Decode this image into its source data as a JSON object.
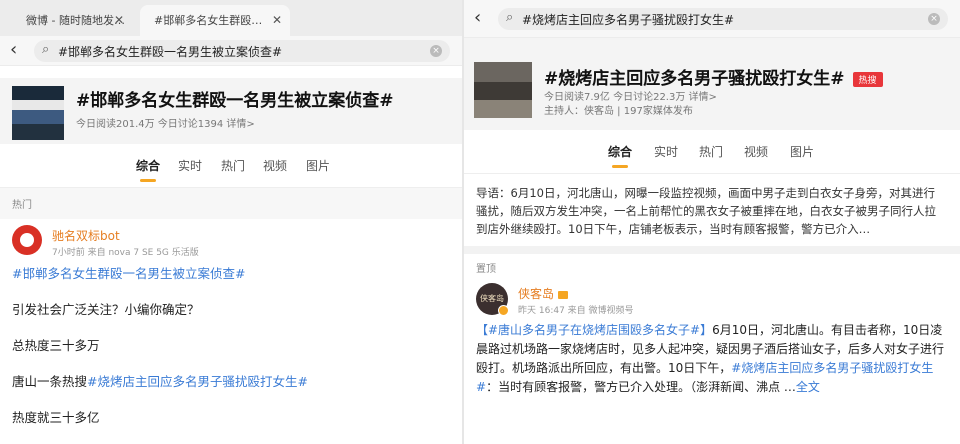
{
  "left": {
    "tabs": [
      {
        "label": "微博 - 随时随地发…"
      },
      {
        "label": "#邯郸多名女生群殴…"
      }
    ],
    "search_query": "#邯郸多名女生群殴一名男生被立案侦查#",
    "topic": {
      "title": "#邯郸多名女生群殴一名男生被立案侦查#",
      "stats": "今日阅读201.4万 今日讨论1394 详情>"
    },
    "categories": [
      "综合",
      "实时",
      "热门",
      "视频",
      "图片"
    ],
    "section_label": "热门",
    "post": {
      "username": "驰名双标bot",
      "meta": "7小时前 来自 nova 7 SE 5G 乐活版",
      "hashtag": "#邯郸多名女生群殴一名男生被立案侦查#",
      "line1": "引发社会广泛关注？小编你确定？",
      "line2": "总热度三十多万",
      "line3_prefix": "唐山一条热搜",
      "line3_tag": "#烧烤店主回应多名男子骚扰殴打女生#",
      "line4": "热度就三十多亿"
    }
  },
  "right": {
    "search_query": "#烧烤店主回应多名男子骚扰殴打女生#",
    "topic": {
      "title": "#烧烤店主回应多名男子骚扰殴打女生#",
      "badge": "热搜",
      "stats": "今日阅读7.9亿 今日讨论22.3万 详情>",
      "host": "主持人：侠客岛 | 197家媒体发布"
    },
    "categories": [
      "综合",
      "实时",
      "热门",
      "视频",
      "图片"
    ],
    "intro": "导语：6月10日，河北唐山，网曝一段监控视频，画面中男子走到白衣女子身旁，对其进行骚扰，随后双方发生冲突，一名上前帮忙的黑衣女子被重摔在地，白衣女子被男子同行人拉到店外继续殴打。10日下午，店铺老板表示，当时有顾客报警，警方已介入…",
    "pin_label": "置顶",
    "post": {
      "avatar_text": "侠客岛",
      "username": "侠客岛",
      "meta": "昨天 16:47 来自 微博视频号",
      "tag1": "【#唐山多名男子在烧烤店围殴多名女子#】",
      "text1": "6月10日，河北唐山。有目击者称，10日凌晨路过机场路一家烧烤店时，见多人起冲突，疑因男子酒后搭讪女子，后多人对女子进行殴打。机场路派出所回应，有出警。10日下午，",
      "tag2": "#烧烤店主回应多名男子骚扰殴打女生#",
      "text2": "：当时有顾客报警，警方已介入处理。（澎湃新闻、沸点 …",
      "more": "全文"
    }
  },
  "colors": {
    "hashtag_blue": "#3a7bd5",
    "username_orange": "#e67e22",
    "hot_badge_red": "#e8363a",
    "tab_indicator": "#f5a623"
  }
}
